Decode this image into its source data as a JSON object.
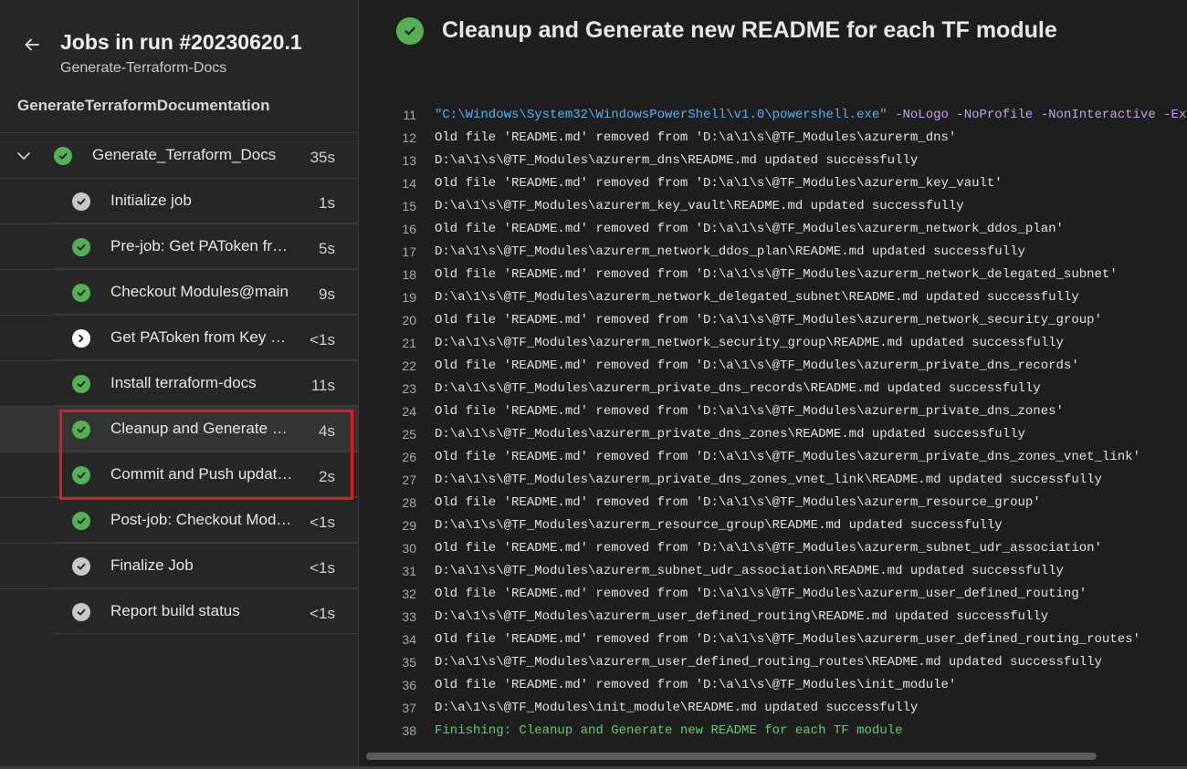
{
  "sidebar": {
    "run_title": "Jobs in run #20230620.1",
    "pipeline_name": "Generate-Terraform-Docs",
    "stage_name": "GenerateTerraformDocumentation",
    "parent_job": {
      "label": "Generate_Terraform_Docs",
      "duration": "35s",
      "status": "success"
    },
    "steps": [
      {
        "label": "Initialize job",
        "duration": "1s",
        "status": "done"
      },
      {
        "label": "Pre-job: Get PAToken from Key Vault",
        "duration": "5s",
        "status": "success"
      },
      {
        "label": "Checkout Modules@main",
        "duration": "9s",
        "status": "success"
      },
      {
        "label": "Get PAToken from Key Vault",
        "duration": "<1s",
        "status": "skipped"
      },
      {
        "label": "Install terraform-docs",
        "duration": "11s",
        "status": "success"
      },
      {
        "label": "Cleanup and Generate new README for each TF module",
        "duration": "4s",
        "status": "success",
        "selected": true
      },
      {
        "label": "Commit and Push updates",
        "duration": "2s",
        "status": "success"
      },
      {
        "label": "Post-job: Checkout Modules@main",
        "duration": "<1s",
        "status": "success"
      },
      {
        "label": "Finalize Job",
        "duration": "<1s",
        "status": "done"
      },
      {
        "label": "Report build status",
        "duration": "<1s",
        "status": "done"
      }
    ]
  },
  "main": {
    "task_title": "Cleanup and Generate new README for each TF module",
    "log_lines": [
      {
        "n": "11",
        "text": "\"C:\\Windows\\System32\\WindowsPowerShell\\v1.0\\powershell.exe\"",
        "args": " -NoLogo -NoProfile -NonInteractive -ExecutionPolicy Unrestricted -Command",
        "kind": "cmd"
      },
      {
        "n": "12",
        "text": "Old file 'README.md' removed from 'D:\\a\\1\\s\\@TF_Modules\\azurerm_dns'"
      },
      {
        "n": "13",
        "text": "D:\\a\\1\\s\\@TF_Modules\\azurerm_dns\\README.md updated successfully"
      },
      {
        "n": "14",
        "text": "Old file 'README.md' removed from 'D:\\a\\1\\s\\@TF_Modules\\azurerm_key_vault'"
      },
      {
        "n": "15",
        "text": "D:\\a\\1\\s\\@TF_Modules\\azurerm_key_vault\\README.md updated successfully"
      },
      {
        "n": "16",
        "text": "Old file 'README.md' removed from 'D:\\a\\1\\s\\@TF_Modules\\azurerm_network_ddos_plan'"
      },
      {
        "n": "17",
        "text": "D:\\a\\1\\s\\@TF_Modules\\azurerm_network_ddos_plan\\README.md updated successfully"
      },
      {
        "n": "18",
        "text": "Old file 'README.md' removed from 'D:\\a\\1\\s\\@TF_Modules\\azurerm_network_delegated_subnet'"
      },
      {
        "n": "19",
        "text": "D:\\a\\1\\s\\@TF_Modules\\azurerm_network_delegated_subnet\\README.md updated successfully"
      },
      {
        "n": "20",
        "text": "Old file 'README.md' removed from 'D:\\a\\1\\s\\@TF_Modules\\azurerm_network_security_group'"
      },
      {
        "n": "21",
        "text": "D:\\a\\1\\s\\@TF_Modules\\azurerm_network_security_group\\README.md updated successfully"
      },
      {
        "n": "22",
        "text": "Old file 'README.md' removed from 'D:\\a\\1\\s\\@TF_Modules\\azurerm_private_dns_records'"
      },
      {
        "n": "23",
        "text": "D:\\a\\1\\s\\@TF_Modules\\azurerm_private_dns_records\\README.md updated successfully"
      },
      {
        "n": "24",
        "text": "Old file 'README.md' removed from 'D:\\a\\1\\s\\@TF_Modules\\azurerm_private_dns_zones'"
      },
      {
        "n": "25",
        "text": "D:\\a\\1\\s\\@TF_Modules\\azurerm_private_dns_zones\\README.md updated successfully"
      },
      {
        "n": "26",
        "text": "Old file 'README.md' removed from 'D:\\a\\1\\s\\@TF_Modules\\azurerm_private_dns_zones_vnet_link'"
      },
      {
        "n": "27",
        "text": "D:\\a\\1\\s\\@TF_Modules\\azurerm_private_dns_zones_vnet_link\\README.md updated successfully"
      },
      {
        "n": "28",
        "text": "Old file 'README.md' removed from 'D:\\a\\1\\s\\@TF_Modules\\azurerm_resource_group'"
      },
      {
        "n": "29",
        "text": "D:\\a\\1\\s\\@TF_Modules\\azurerm_resource_group\\README.md updated successfully"
      },
      {
        "n": "30",
        "text": "Old file 'README.md' removed from 'D:\\a\\1\\s\\@TF_Modules\\azurerm_subnet_udr_association'"
      },
      {
        "n": "31",
        "text": "D:\\a\\1\\s\\@TF_Modules\\azurerm_subnet_udr_association\\README.md updated successfully"
      },
      {
        "n": "32",
        "text": "Old file 'README.md' removed from 'D:\\a\\1\\s\\@TF_Modules\\azurerm_user_defined_routing'"
      },
      {
        "n": "33",
        "text": "D:\\a\\1\\s\\@TF_Modules\\azurerm_user_defined_routing\\README.md updated successfully"
      },
      {
        "n": "34",
        "text": "Old file 'README.md' removed from 'D:\\a\\1\\s\\@TF_Modules\\azurerm_user_defined_routing_routes'"
      },
      {
        "n": "35",
        "text": "D:\\a\\1\\s\\@TF_Modules\\azurerm_user_defined_routing_routes\\README.md updated successfully"
      },
      {
        "n": "36",
        "text": "Old file 'README.md' removed from 'D:\\a\\1\\s\\@TF_Modules\\init_module'"
      },
      {
        "n": "37",
        "text": "D:\\a\\1\\s\\@TF_Modules\\init_module\\README.md updated successfully"
      },
      {
        "n": "38",
        "text": "Finishing: Cleanup and Generate new README for each TF module",
        "kind": "finish"
      }
    ]
  },
  "icons": {
    "back": "arrow-left-icon",
    "expand": "chevron-down-icon",
    "success": "check-circle-icon",
    "skipped": "skip-forward-icon"
  },
  "colors": {
    "success": "#54b054",
    "highlight": "#e01b24",
    "command": "#5ab0f0",
    "finish": "#5fd068"
  }
}
